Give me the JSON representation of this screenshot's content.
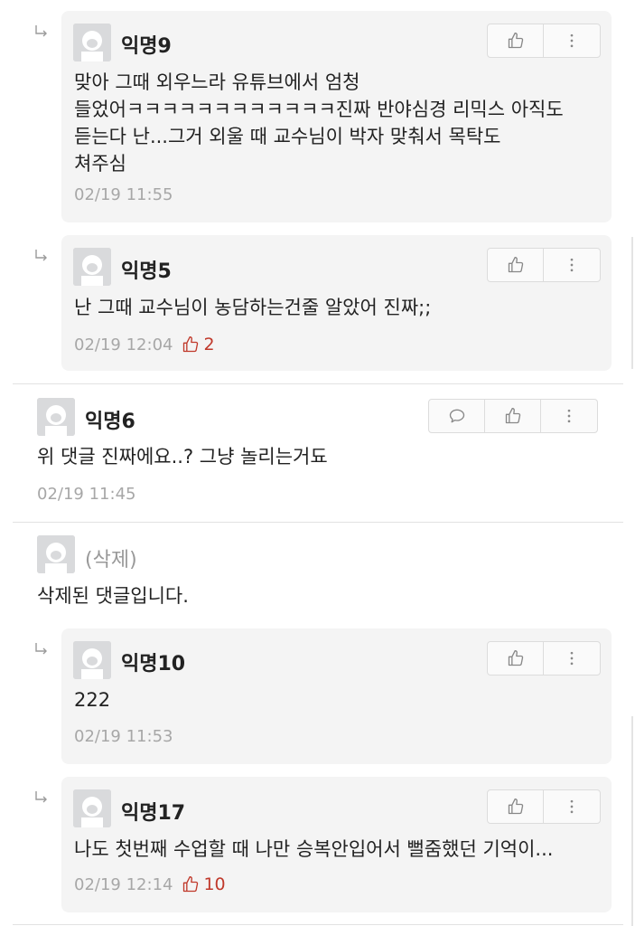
{
  "comments": [
    {
      "nick": "익명9",
      "text": "맞아 그때 외우느라 유튜브에서 엄청\n들었어ㅋㅋㅋㅋㅋㅋㅋㅋㅋㅋㅋㅋ진짜 반야심경 리믹스 아직도\n듣는다 난...그거 외울 때 교수님이 박자 맞춰서 목탁도\n쳐주심",
      "time": "02/19 11:55"
    },
    {
      "nick": "익명5",
      "text": "난 그때 교수님이 농담하는건줄 알았어 진짜;;",
      "time": "02/19 12:04",
      "likes": "2"
    },
    {
      "nick": "익명6",
      "text": "위 댓글 진짜에요..? 그냥 놀리는거됴",
      "time": "02/19 11:45"
    },
    {
      "nick": "(삭제)",
      "text": "삭제된 댓글입니다."
    },
    {
      "nick": "익명10",
      "text": "222",
      "time": "02/19 11:53"
    },
    {
      "nick": "익명17",
      "text": "나도 첫번째 수업할 때 나만 승복안입어서 뻘줌했던 기억이...",
      "time": "02/19 12:14",
      "likes": "10"
    }
  ],
  "icons": {
    "reply_arrow": "reply-arrow-icon",
    "like": "thumbs-up-icon",
    "more": "more-vertical-icon",
    "comment": "comment-bubble-icon",
    "avatar": "default-avatar-icon"
  },
  "colors": {
    "reply_background": "#f4f4f4",
    "like_count": "#c0392b",
    "timestamp": "#a7a7a7"
  }
}
